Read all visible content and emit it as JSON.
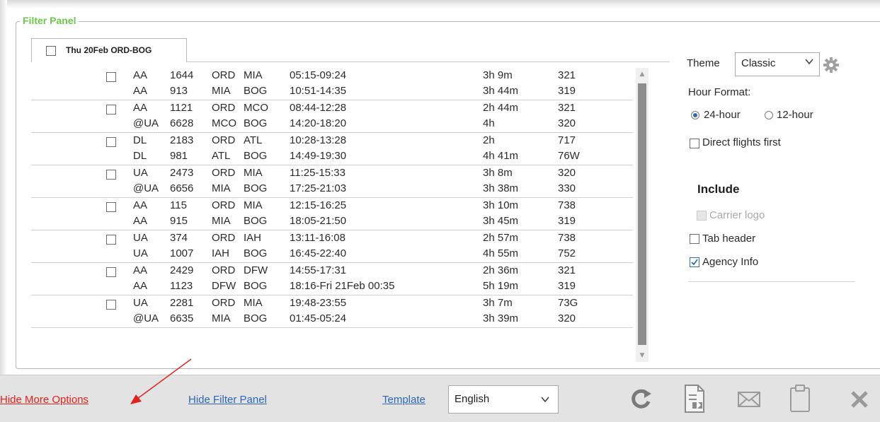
{
  "filter_panel": {
    "title": "Filter Panel"
  },
  "tab": {
    "label": "Thu 20Feb ORD-BOG"
  },
  "flights": [
    {
      "segments": [
        {
          "airline": "AA",
          "number": "1644",
          "from": "ORD",
          "to": "MIA",
          "time": "05:15-09:24",
          "duration": "3h 9m",
          "equipment": "321"
        },
        {
          "airline": "AA",
          "number": "913",
          "from": "MIA",
          "to": "BOG",
          "time": "10:51-14:35",
          "duration": "3h 44m",
          "equipment": "319"
        }
      ]
    },
    {
      "segments": [
        {
          "airline": "AA",
          "number": "1121",
          "from": "ORD",
          "to": "MCO",
          "time": "08:44-12:28",
          "duration": "2h 44m",
          "equipment": "321"
        },
        {
          "airline": "@UA",
          "number": "6628",
          "from": "MCO",
          "to": "BOG",
          "time": "14:20-18:20",
          "duration": "4h",
          "equipment": "320"
        }
      ]
    },
    {
      "segments": [
        {
          "airline": "DL",
          "number": "2183",
          "from": "ORD",
          "to": "ATL",
          "time": "10:28-13:28",
          "duration": "2h",
          "equipment": "717"
        },
        {
          "airline": "DL",
          "number": "981",
          "from": "ATL",
          "to": "BOG",
          "time": "14:49-19:30",
          "duration": "4h 41m",
          "equipment": "76W"
        }
      ]
    },
    {
      "segments": [
        {
          "airline": "UA",
          "number": "2473",
          "from": "ORD",
          "to": "MIA",
          "time": "11:25-15:33",
          "duration": "3h 8m",
          "equipment": "320"
        },
        {
          "airline": "@UA",
          "number": "6656",
          "from": "MIA",
          "to": "BOG",
          "time": "17:25-21:03",
          "duration": "3h 38m",
          "equipment": "330"
        }
      ]
    },
    {
      "segments": [
        {
          "airline": "AA",
          "number": "115",
          "from": "ORD",
          "to": "MIA",
          "time": "12:15-16:25",
          "duration": "3h 10m",
          "equipment": "738"
        },
        {
          "airline": "AA",
          "number": "915",
          "from": "MIA",
          "to": "BOG",
          "time": "18:05-21:50",
          "duration": "3h 45m",
          "equipment": "319"
        }
      ]
    },
    {
      "segments": [
        {
          "airline": "UA",
          "number": "374",
          "from": "ORD",
          "to": "IAH",
          "time": "13:11-16:08",
          "duration": "2h 57m",
          "equipment": "738"
        },
        {
          "airline": "UA",
          "number": "1007",
          "from": "IAH",
          "to": "BOG",
          "time": "16:45-22:40",
          "duration": "4h 55m",
          "equipment": "752"
        }
      ]
    },
    {
      "segments": [
        {
          "airline": "AA",
          "number": "2429",
          "from": "ORD",
          "to": "DFW",
          "time": "14:55-17:31",
          "duration": "2h 36m",
          "equipment": "321"
        },
        {
          "airline": "AA",
          "number": "1123",
          "from": "DFW",
          "to": "BOG",
          "time": "18:16-Fri 21Feb 00:35",
          "duration": "5h 19m",
          "equipment": "319"
        }
      ]
    },
    {
      "segments": [
        {
          "airline": "UA",
          "number": "2281",
          "from": "ORD",
          "to": "MIA",
          "time": "19:48-23:55",
          "duration": "3h 7m",
          "equipment": "73G"
        },
        {
          "airline": "@UA",
          "number": "6635",
          "from": "MIA",
          "to": "BOG",
          "time": "01:45-05:24",
          "duration": "3h 39m",
          "equipment": "320"
        }
      ]
    }
  ],
  "options": {
    "theme_label": "Theme",
    "theme_value": "Classic",
    "hour_format_label": "Hour Format:",
    "hour_24": "24-hour",
    "hour_12": "12-hour",
    "direct_first": "Direct flights first",
    "include_title": "Include",
    "carrier_logo": "Carrier logo",
    "tab_header": "Tab header",
    "agency_info": "Agency Info"
  },
  "bottom": {
    "hide_more_options": "Hide More Options",
    "hide_filter_panel": "Hide Filter Panel",
    "template": "Template",
    "language": "English"
  },
  "colors": {
    "accent_green": "#6ac84a",
    "link_red": "#e0231c",
    "link_blue": "#2b67b4"
  }
}
